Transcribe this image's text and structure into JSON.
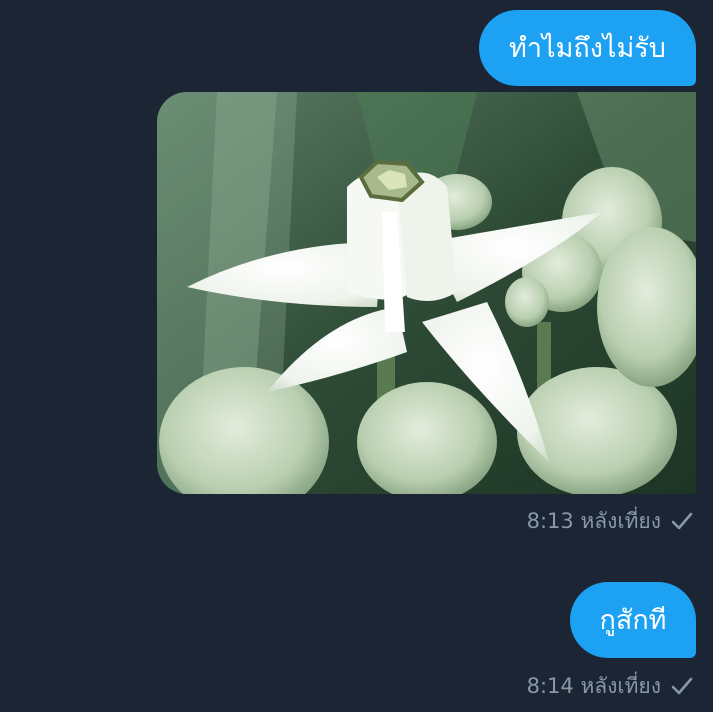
{
  "messages": [
    {
      "type": "text",
      "text": "ทำไมถึงไม่รับ"
    },
    {
      "type": "image",
      "image_icon": "crown-flower-photo",
      "time": "8:13 หลังเที่ยง",
      "status_icon": "check-icon"
    },
    {
      "type": "text",
      "text": "กูสักที",
      "time": "8:14 หลังเที่ยง",
      "status_icon": "check-icon"
    }
  ],
  "colors": {
    "background": "#1b2533",
    "bubble": "#1da1f2",
    "bubble_text": "#ffffff",
    "meta_text": "#8899a6"
  }
}
